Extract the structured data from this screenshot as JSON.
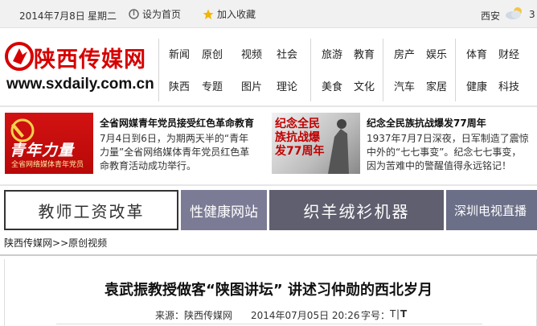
{
  "topbar": {
    "date": "2014年7月8日",
    "weekday": "星期二",
    "home_label": "设为首页",
    "favorite_label": "加入收藏",
    "city": "西安",
    "temp": "3"
  },
  "logo": {
    "name": "陕西传媒网",
    "url": "www.sxdaily.com.cn"
  },
  "nav": {
    "group1_row1": [
      "新闻",
      "原创",
      "视频",
      "社会"
    ],
    "group1_row2": [
      "陕西",
      "专题",
      "图片",
      "理论"
    ],
    "group2_row1": [
      "旅游",
      "教育",
      "房产",
      "娱乐",
      "体育",
      "财经"
    ],
    "group2_row2": [
      "美食",
      "文化",
      "汽车",
      "家居",
      "健康",
      "科技"
    ]
  },
  "news": [
    {
      "image_text": "青年力量",
      "image_subtext": "全省网络媒体青年党员",
      "title": "全省网媒青年党员接受红色革命教育",
      "desc": [
        "7月4日到6日，为期两天半的“青年",
        "力量”全省网络媒体青年党员红色革",
        "命教育活动成功举行。"
      ]
    },
    {
      "image_text": "纪念全民族抗战爆发77周年",
      "title": "纪念全民族抗战爆发77周年",
      "desc": [
        "1937年7月7日深夜，日军制造了震惊",
        "中外的“七七事变”。纪念七七事变，",
        "因为苦难中的警醒值得永远铭记！"
      ]
    }
  ],
  "banners": [
    "教师工资改革",
    "性健康网站",
    "织羊绒衫机器",
    "深圳电视直播"
  ],
  "breadcrumb": {
    "site": "陕西传媒网",
    "sep": ">>",
    "section": "原创视频"
  },
  "article": {
    "title": "袁武振教授做客“陕图讲坛” 讲述习仲勋的西北岁月",
    "source": "来源：陕西传媒网",
    "time": "2014年07月05日 20:26",
    "font_label": "字号：",
    "font_small": "T",
    "font_sep": "|",
    "font_large": "T"
  },
  "colors": {
    "brand_red": "#d60000",
    "banner_dark": "#5f5f6f"
  }
}
